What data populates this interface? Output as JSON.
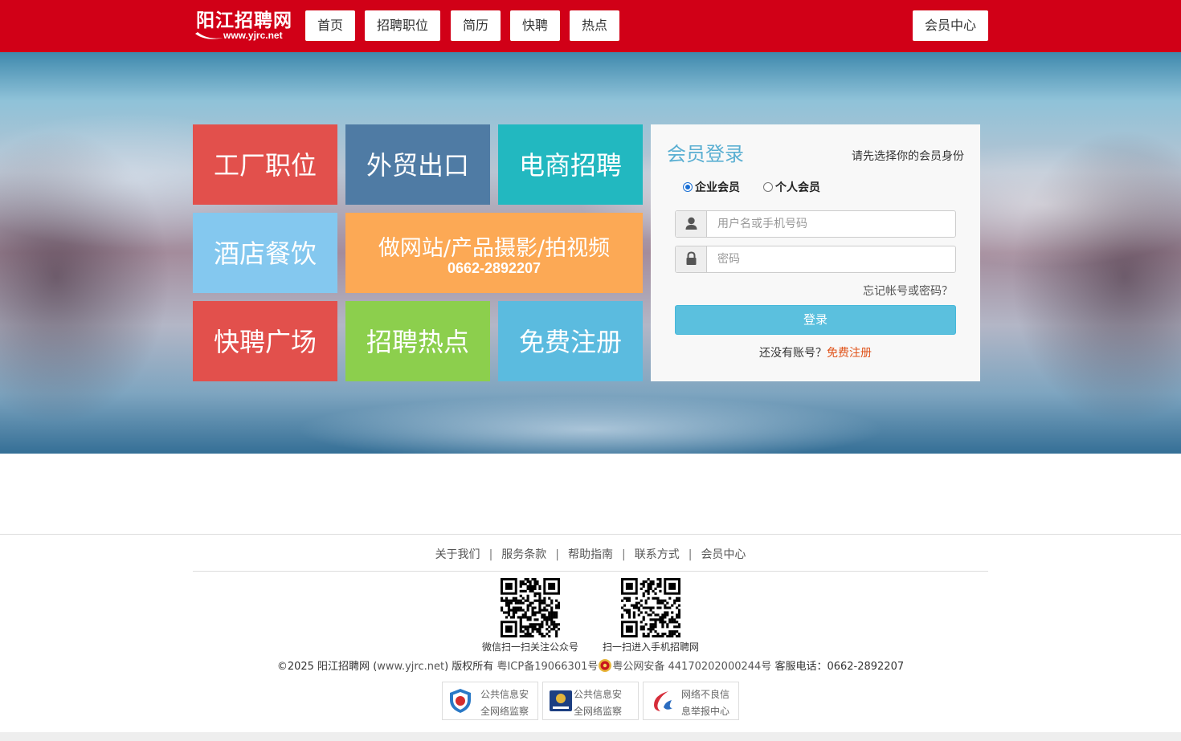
{
  "header": {
    "logo": {
      "main": "阳江招聘网",
      "sub": "www.yjrc.net"
    },
    "nav": [
      "首页",
      "招聘职位",
      "简历",
      "快聘",
      "热点"
    ],
    "member_center": "会员中心"
  },
  "tiles": [
    {
      "label": "工厂职位",
      "color": "#e2504c"
    },
    {
      "label": "外贸出口",
      "color": "#4f7ba4"
    },
    {
      "label": "电商招聘",
      "color": "#22b8c0"
    },
    {
      "label": "酒店餐饮",
      "color": "#84c8ef"
    },
    {
      "label": "做网站/产品摄影/拍视频",
      "phone": "0662-2892207",
      "color": "#fca955"
    },
    {
      "label": "快聘广场",
      "color": "#e2504c"
    },
    {
      "label": "招聘热点",
      "color": "#8ccf4d"
    },
    {
      "label": "免费注册",
      "color": "#5bbbdf"
    }
  ],
  "login": {
    "title": "会员登录",
    "hint": "请先选择你的会员身份",
    "roles": [
      "企业会员",
      "个人会员"
    ],
    "selected_role": "企业会员",
    "username_placeholder": "用户名或手机号码",
    "password_placeholder": "密码",
    "forgot": "忘记帐号或密码？",
    "button": "登录",
    "no_account": "还没有账号？",
    "register": "免费注册"
  },
  "footer": {
    "links": [
      "关于我们",
      "服务条款",
      "帮助指南",
      "联系方式",
      "会员中心"
    ],
    "separator": "|",
    "qr_captions": [
      "微信扫一扫关注公众号",
      "扫一扫进入手机招聘网"
    ],
    "copyright": {
      "prefix": "©2025 阳江招聘网 (",
      "domain": "www.yjrc.net",
      "suffix": ") 版权所有",
      "icp": "粤ICP备19066301号",
      "police": "粤公网安备 44170202000244号",
      "service": "客服电话：0662-2892207"
    },
    "badges": [
      {
        "line1": "公共信息安",
        "line2": "全网络监察"
      },
      {
        "line1": "公共信息安",
        "line2": "全网络监察"
      },
      {
        "line1": "网络不良信",
        "line2": "息举报中心"
      }
    ]
  },
  "colors": {
    "brand_red": "#d10017",
    "login_title": "#5aafd2",
    "login_button": "#5bc0de",
    "register_link": "#e0531a"
  }
}
